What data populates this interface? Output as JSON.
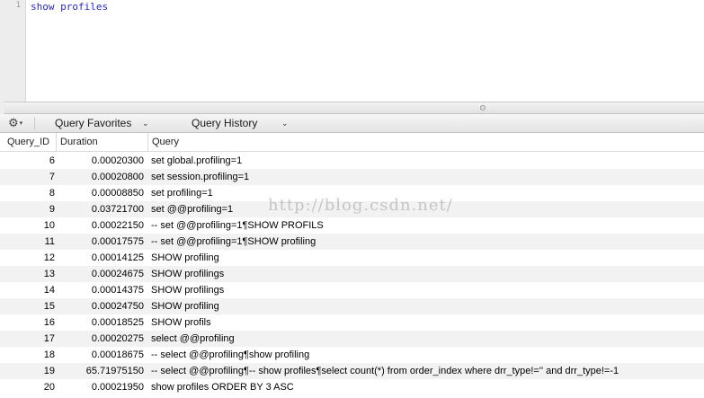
{
  "editor": {
    "line_number": "1",
    "code": "show profiles"
  },
  "toolbar": {
    "gear_icon": "⚙",
    "gear_caret": "▾",
    "favorites_label": "Query Favorites",
    "favorites_chevron": "⌄",
    "history_label": "Query History",
    "history_chevron": "⌄"
  },
  "results": {
    "columns": [
      "Query_ID",
      "Duration",
      "Query"
    ],
    "rows": [
      {
        "id": "6",
        "duration": "0.00020300",
        "query": "set global.profiling=1"
      },
      {
        "id": "7",
        "duration": "0.00020800",
        "query": "set session.profiling=1"
      },
      {
        "id": "8",
        "duration": "0.00008850",
        "query": "set profiling=1"
      },
      {
        "id": "9",
        "duration": "0.03721700",
        "query": "set @@profiling=1"
      },
      {
        "id": "10",
        "duration": "0.00022150",
        "query": "-- set @@profiling=1¶SHOW PROFILS"
      },
      {
        "id": "11",
        "duration": "0.00017575",
        "query": "-- set @@profiling=1¶SHOW profiling"
      },
      {
        "id": "12",
        "duration": "0.00014125",
        "query": "SHOW profiling"
      },
      {
        "id": "13",
        "duration": "0.00024675",
        "query": "SHOW profilings"
      },
      {
        "id": "14",
        "duration": "0.00014375",
        "query": "SHOW profilings"
      },
      {
        "id": "15",
        "duration": "0.00024750",
        "query": "SHOW profiling"
      },
      {
        "id": "16",
        "duration": "0.00018525",
        "query": "SHOW profils"
      },
      {
        "id": "17",
        "duration": "0.00020275",
        "query": "select @@profiling"
      },
      {
        "id": "18",
        "duration": "0.00018675",
        "query": "-- select @@profiling¶show profiling"
      },
      {
        "id": "19",
        "duration": "65.71975150",
        "query": "-- select @@profiling¶-- show profiles¶select count(*) from order_index where drr_type!='' and drr_type!=-1"
      },
      {
        "id": "20",
        "duration": "0.00021950",
        "query": "show profiles  ORDER BY 3 ASC"
      }
    ]
  },
  "watermark": "http://blog.csdn.net/"
}
